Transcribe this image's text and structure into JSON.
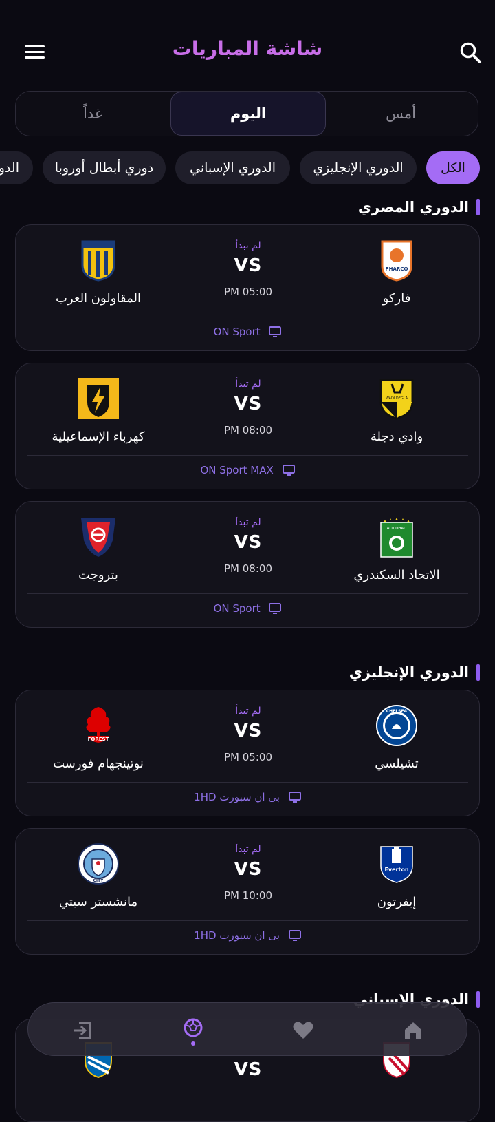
{
  "header": {
    "title": "شاشة المباريات"
  },
  "day_tabs": {
    "yesterday": "أمس",
    "today": "اليوم",
    "tomorrow": "غداً"
  },
  "chips": [
    "الكل",
    "الدوري الإنجليزي",
    "الدوري الإسباني",
    "دوري أبطال أوروبا",
    "الدوري"
  ],
  "sections": [
    {
      "title": "الدوري المصري",
      "matches": [
        {
          "home": "فاركو",
          "away": "المقاولون العرب",
          "status": "لم تبدأ",
          "vs": "VS",
          "time": "PM 05:00",
          "channel": "ON Sport"
        },
        {
          "home": "وادي دجلة",
          "away": "كهرباء الإسماعيلية",
          "status": "لم تبدأ",
          "vs": "VS",
          "time": "PM 08:00",
          "channel": "ON Sport MAX"
        },
        {
          "home": "الاتحاد السكندري",
          "away": "بتروجت",
          "status": "لم تبدأ",
          "vs": "VS",
          "time": "PM 08:00",
          "channel": "ON Sport"
        }
      ]
    },
    {
      "title": "الدوري الإنجليزي",
      "matches": [
        {
          "home": "تشيلسي",
          "away": "نوتينجهام فورست",
          "status": "لم تبدأ",
          "vs": "VS",
          "time": "PM 05:00",
          "channel": "بى ان سبورت 1HD"
        },
        {
          "home": "إيفرتون",
          "away": "مانشستر سيتي",
          "status": "لم تبدأ",
          "vs": "VS",
          "time": "PM 10:00",
          "channel": "بى ان سبورت 1HD"
        }
      ]
    },
    {
      "title": "الدوري الإسباني",
      "matches": [
        {
          "vs": "VS"
        }
      ]
    }
  ],
  "logo_text": {
    "pharco": "PHARCO",
    "wadi": "WADI DEGLA",
    "ittihad": "ALITTIHAD",
    "chelsea": "CHELSEA",
    "forest": "FOREST",
    "everton": "Everton",
    "city": "CITY"
  },
  "colors": {
    "accent": "#a46cf5",
    "title": "#c86ee8",
    "background": "#0b0a12",
    "card": "#13121b"
  },
  "icons": {
    "menu": "menu-icon",
    "search": "search-icon",
    "tv": "tv-icon",
    "nav": [
      "home-icon",
      "heart-icon",
      "football-icon",
      "logout-icon"
    ]
  }
}
